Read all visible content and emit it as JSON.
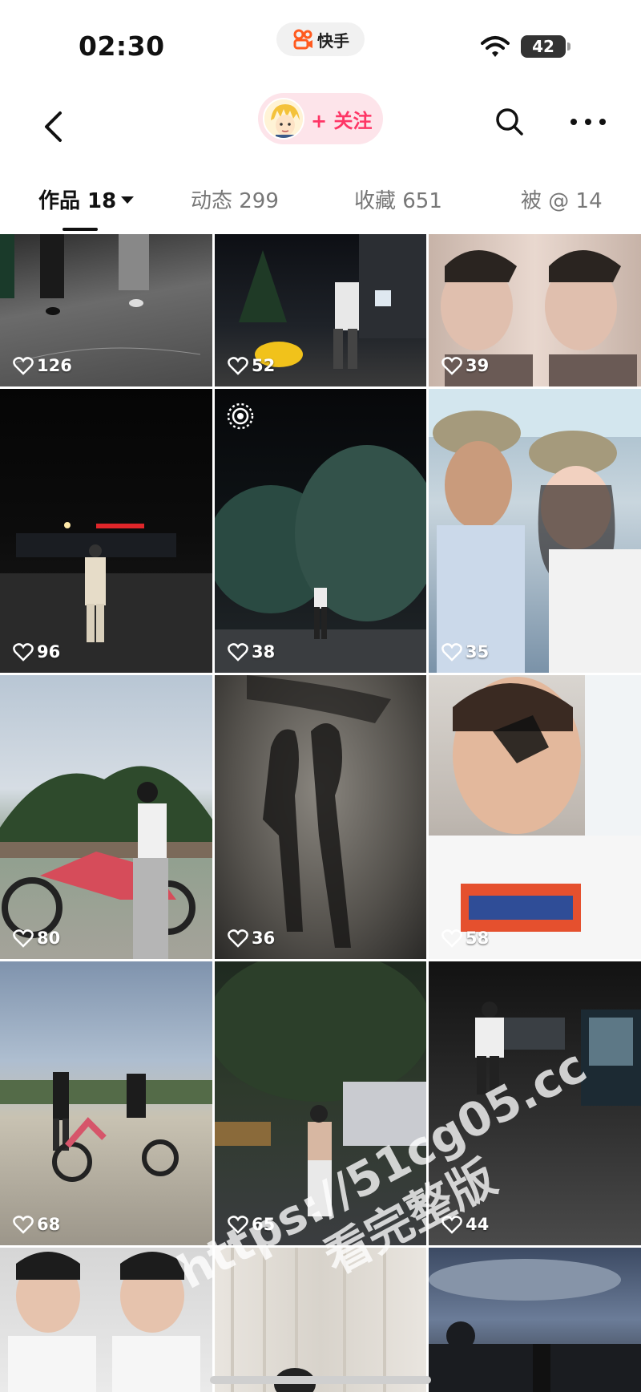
{
  "status_bar": {
    "time": "02:30",
    "app_name": "快手",
    "battery": "42"
  },
  "nav": {
    "follow_label": "+ 关注"
  },
  "tabs": [
    {
      "label": "作品 18",
      "active": true
    },
    {
      "label": "动态 299",
      "active": false
    },
    {
      "label": "收藏 651",
      "active": false
    },
    {
      "label": "被 @ 14",
      "active": false
    }
  ],
  "grid": {
    "items": [
      {
        "likes": "126"
      },
      {
        "likes": "52"
      },
      {
        "likes": "39"
      },
      {
        "likes": "96"
      },
      {
        "likes": "38",
        "badge": "live-icon"
      },
      {
        "likes": "35"
      },
      {
        "likes": "80"
      },
      {
        "likes": "36"
      },
      {
        "likes": "58"
      },
      {
        "likes": "68"
      },
      {
        "likes": "65"
      },
      {
        "likes": "44"
      },
      {
        "likes": ""
      },
      {
        "likes": ""
      },
      {
        "likes": ""
      }
    ]
  },
  "watermark": {
    "line1": "https://51cg05.cc",
    "line2": "看完整版"
  },
  "colors": {
    "accent": "#fe3666",
    "follow_bg": "#fde4ea"
  }
}
